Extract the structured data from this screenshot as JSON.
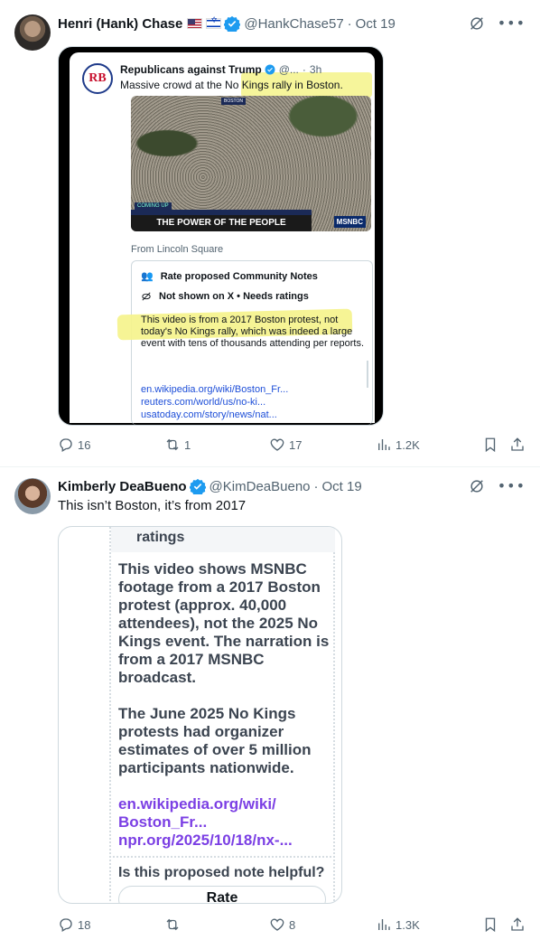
{
  "post1": {
    "author_name": "Henri (Hank) Chase",
    "handle": "@HankChase57",
    "date": "Oct 19",
    "embedded": {
      "author_name": "Republicans against Trump",
      "handle": "@...",
      "time": "3h",
      "text": "Massive crowd at the No Kings rally in Boston.",
      "video_banner": "THE POWER OF THE PEOPLE",
      "video_coming_up": "COMING UP",
      "video_location": "BOSTON",
      "video_network": "MSNBC",
      "from_label": "From Lincoln Square",
      "note_title": "Rate proposed Community Notes",
      "note_status": "Not shown on X • Needs ratings",
      "note_body": "This video is from a 2017 Boston protest, not today's No Kings rally, which was indeed a large event with tens of thousands attending per reports.",
      "note_links": [
        "en.wikipedia.org/wiki/Boston_Fr...",
        "reuters.com/world/us/no-ki...",
        "usatoday.com/story/news/nat..."
      ]
    },
    "actions": {
      "replies": "16",
      "reposts": "1",
      "likes": "17",
      "views": "1.2K"
    }
  },
  "post2": {
    "author_name": "Kimberly DeaBueno",
    "handle": "@KimDeaBueno",
    "date": "Oct 19",
    "text": "This isn’t Boston, it’s from 2017",
    "media": {
      "ratings_label": "ratings",
      "body_p1": "This video shows MSNBC footage from a 2017 Boston protest (approx. 40,000 attendees), not the 2025 No Kings event. The narration is from a 2017 MSNBC broadcast.",
      "body_p2": "The June 2025 No Kings protests had organizer estimates of over 5 million participants nationwide.",
      "links": [
        "en.wikipedia.org/wiki/",
        "Boston_Fr...",
        "npr.org/2025/10/18/nx-..."
      ],
      "question": "Is this proposed note helpful?",
      "rate_label": "Rate"
    },
    "actions": {
      "replies": "18",
      "reposts": "",
      "likes": "8",
      "views": "1.3K"
    }
  },
  "colors": {
    "verified": "#1d9bf0",
    "muted": "#536471",
    "link": "#1d4ed8",
    "highlight": "#f5f38a"
  }
}
